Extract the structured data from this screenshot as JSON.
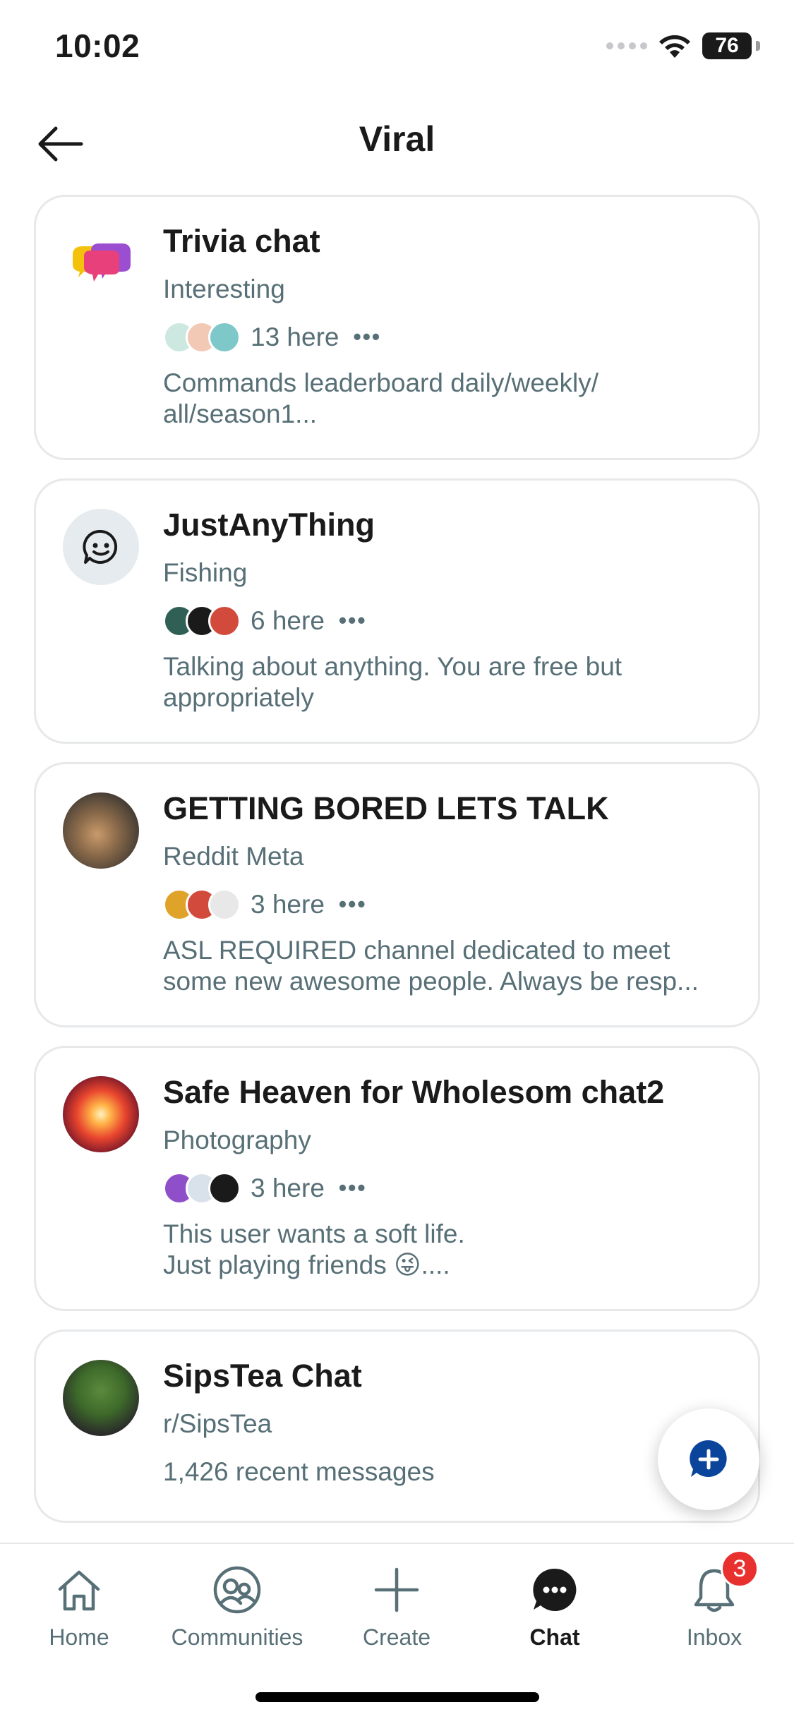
{
  "status_bar": {
    "time": "10:02",
    "battery": "76"
  },
  "header": {
    "title": "Viral"
  },
  "channels": [
    {
      "title": "Trivia chat",
      "subtitle": "Interesting",
      "here": "13 here",
      "description_lines": [
        "Commands leaderboard daily/weekly/",
        "all/season1..."
      ],
      "avatar_icon": "trivia-time-logo"
    },
    {
      "title": "JustAnyThing",
      "subtitle": "Fishing",
      "here": "6 here",
      "description_lines": [
        "Talking about anything. You are free but",
        "appropriately"
      ],
      "avatar_icon": "chat-bubble-icon"
    },
    {
      "title": "GETTING BORED LETS TALK",
      "subtitle": "Reddit Meta",
      "here": "3 here",
      "description_lines": [
        "ASL REQUIRED channel dedicated to meet",
        "some new awesome people. Always be resp..."
      ],
      "avatar_icon": "cat-photo"
    },
    {
      "title": "Safe Heaven for Wholesom chat2",
      "subtitle": "Photography",
      "here": "3 here",
      "description_lines": [
        "This user wants a soft life.",
        "Just playing friends 😜...."
      ],
      "avatar_icon": "phoenix-image"
    },
    {
      "title": "SipsTea Chat",
      "subtitle": "r/SipsTea",
      "recent": "1,426 recent messages",
      "avatar_icon": "frog-image"
    }
  ],
  "nav": {
    "home": "Home",
    "communities": "Communities",
    "create": "Create",
    "chat": "Chat",
    "inbox": "Inbox",
    "inbox_badge": "3"
  },
  "colors": {
    "accent_blue": "#0a449b",
    "muted_text": "#576f76",
    "badge_red": "#e8312f",
    "card_border": "#e6e8ea"
  }
}
